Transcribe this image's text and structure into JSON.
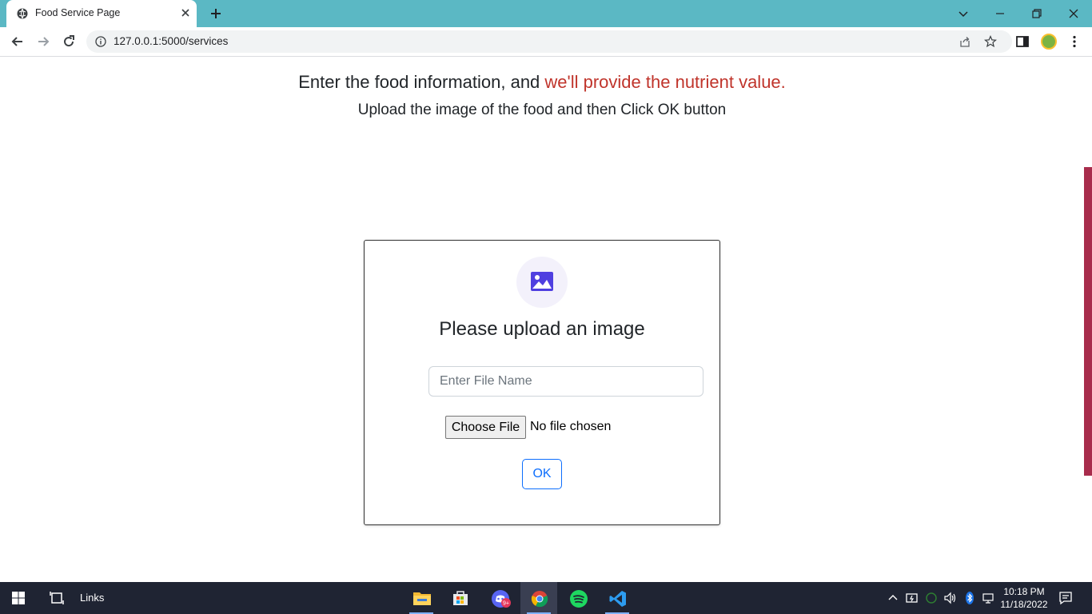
{
  "browser": {
    "tab_title": "Food Service Page",
    "url": "127.0.0.1:5000/services"
  },
  "page": {
    "heading_main": "Enter the food information, and ",
    "heading_accent": "we'll provide the nutrient value.",
    "subheading": "Upload the image of the food and then Click OK button",
    "accent_color": "#c0342b"
  },
  "upload_card": {
    "title": "Please upload an image",
    "file_name_placeholder": "Enter File Name",
    "choose_file_label": "Choose File",
    "no_file_text": "No file chosen",
    "ok_label": "OK"
  },
  "taskbar": {
    "links_label": "Links",
    "time": "10:18 PM",
    "date": "11/18/2022",
    "discord_badge": "9+"
  }
}
